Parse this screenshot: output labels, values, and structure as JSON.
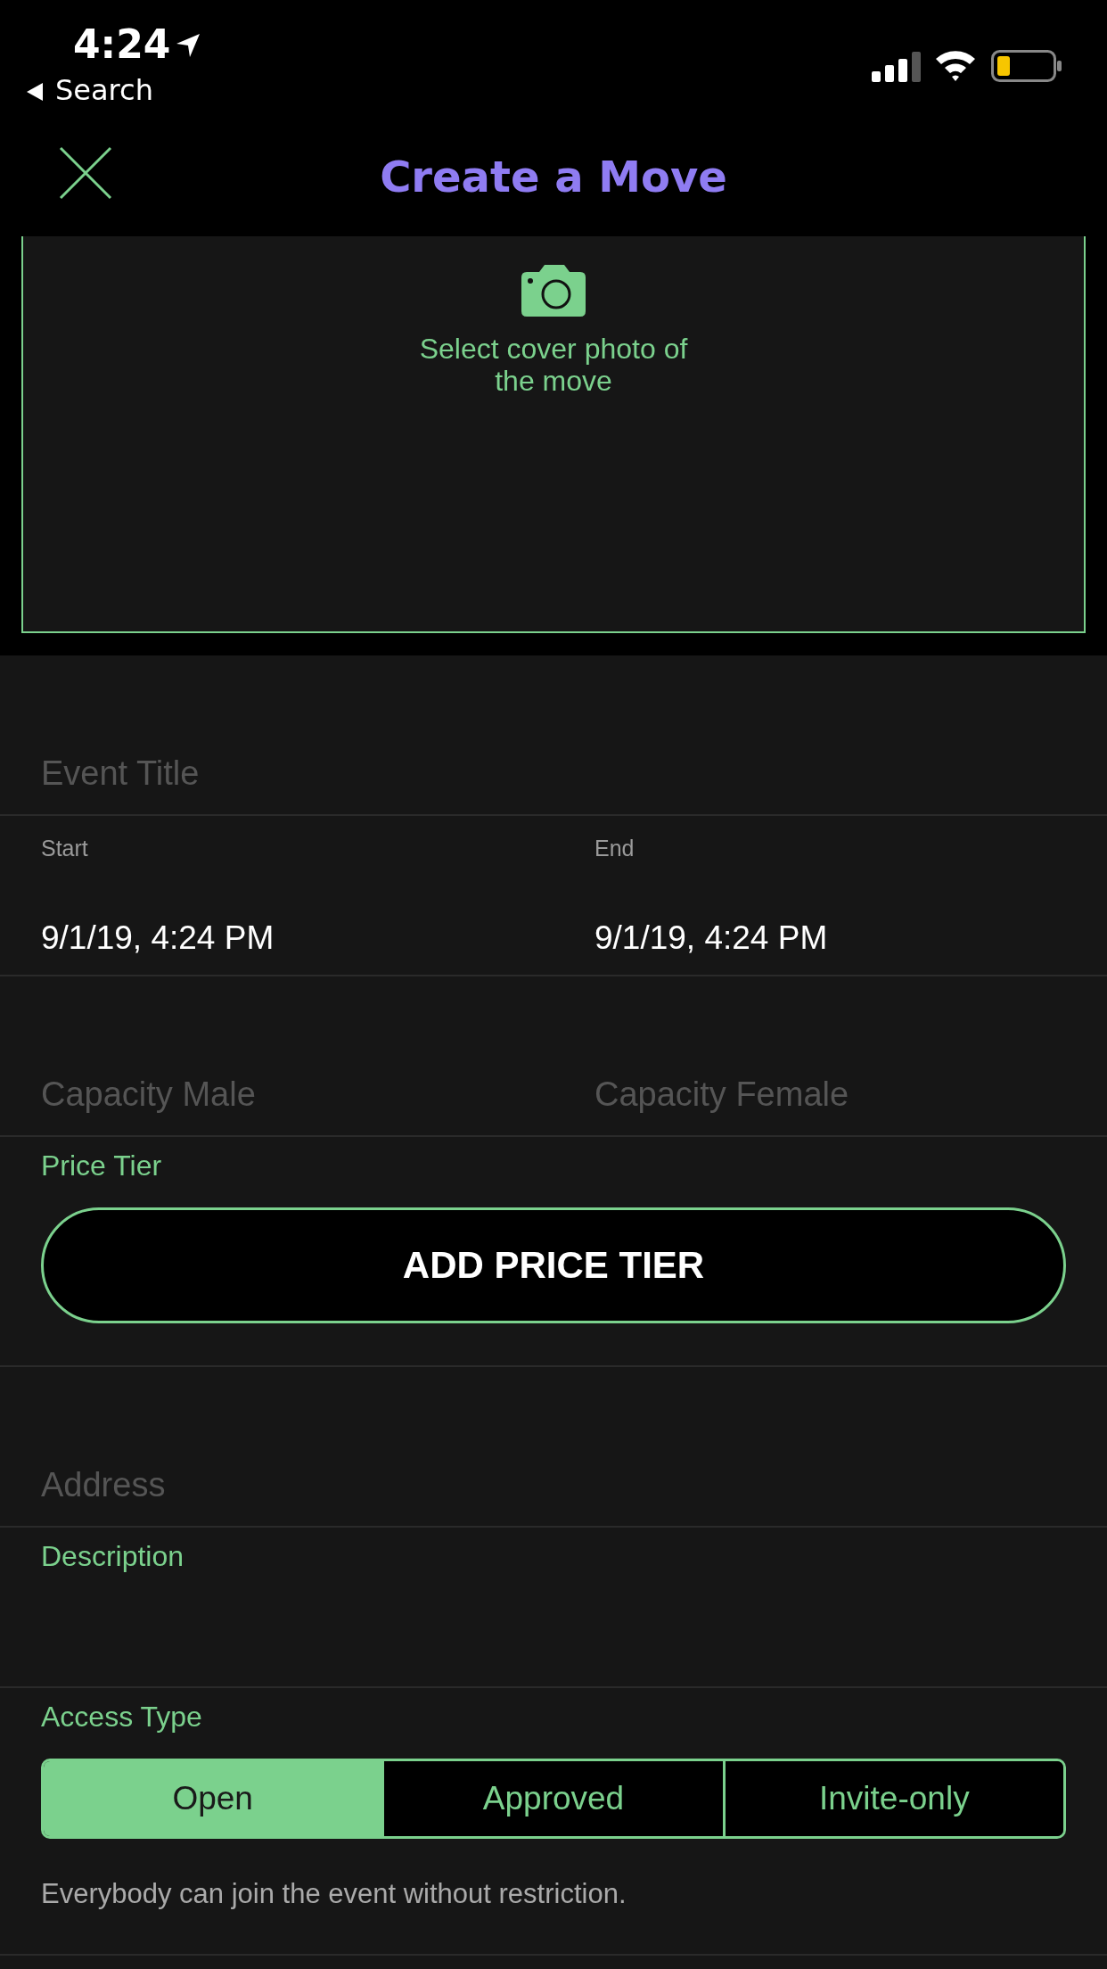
{
  "status_bar": {
    "time": "4:24",
    "back": "Search"
  },
  "nav": {
    "title": "Create a Move"
  },
  "cover": {
    "label": "Select cover photo of the move"
  },
  "form": {
    "event_title": {
      "placeholder": "Event Title"
    },
    "start": {
      "label": "Start",
      "value": "9/1/19, 4:24 PM"
    },
    "end": {
      "label": "End",
      "value": "9/1/19, 4:24 PM"
    },
    "capacity_male": {
      "placeholder": "Capacity Male"
    },
    "capacity_female": {
      "placeholder": "Capacity Female"
    },
    "price_tier": {
      "label": "Price Tier",
      "button": "ADD PRICE TIER"
    },
    "address": {
      "placeholder": "Address"
    },
    "description": {
      "label": "Description"
    },
    "access_type": {
      "label": "Access Type",
      "options": [
        {
          "label": "Open",
          "selected": true
        },
        {
          "label": "Approved",
          "selected": false
        },
        {
          "label": "Invite-only",
          "selected": false
        }
      ],
      "note": "Everybody can join the event without restriction."
    }
  }
}
